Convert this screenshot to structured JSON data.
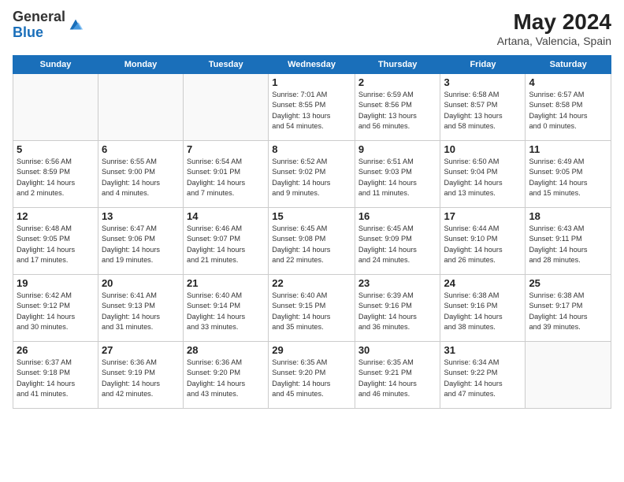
{
  "header": {
    "logo_general": "General",
    "logo_blue": "Blue",
    "month_year": "May 2024",
    "location": "Artana, Valencia, Spain"
  },
  "days_of_week": [
    "Sunday",
    "Monday",
    "Tuesday",
    "Wednesday",
    "Thursday",
    "Friday",
    "Saturday"
  ],
  "weeks": [
    [
      {
        "day": "",
        "info": ""
      },
      {
        "day": "",
        "info": ""
      },
      {
        "day": "",
        "info": ""
      },
      {
        "day": "1",
        "info": "Sunrise: 7:01 AM\nSunset: 8:55 PM\nDaylight: 13 hours\nand 54 minutes."
      },
      {
        "day": "2",
        "info": "Sunrise: 6:59 AM\nSunset: 8:56 PM\nDaylight: 13 hours\nand 56 minutes."
      },
      {
        "day": "3",
        "info": "Sunrise: 6:58 AM\nSunset: 8:57 PM\nDaylight: 13 hours\nand 58 minutes."
      },
      {
        "day": "4",
        "info": "Sunrise: 6:57 AM\nSunset: 8:58 PM\nDaylight: 14 hours\nand 0 minutes."
      }
    ],
    [
      {
        "day": "5",
        "info": "Sunrise: 6:56 AM\nSunset: 8:59 PM\nDaylight: 14 hours\nand 2 minutes."
      },
      {
        "day": "6",
        "info": "Sunrise: 6:55 AM\nSunset: 9:00 PM\nDaylight: 14 hours\nand 4 minutes."
      },
      {
        "day": "7",
        "info": "Sunrise: 6:54 AM\nSunset: 9:01 PM\nDaylight: 14 hours\nand 7 minutes."
      },
      {
        "day": "8",
        "info": "Sunrise: 6:52 AM\nSunset: 9:02 PM\nDaylight: 14 hours\nand 9 minutes."
      },
      {
        "day": "9",
        "info": "Sunrise: 6:51 AM\nSunset: 9:03 PM\nDaylight: 14 hours\nand 11 minutes."
      },
      {
        "day": "10",
        "info": "Sunrise: 6:50 AM\nSunset: 9:04 PM\nDaylight: 14 hours\nand 13 minutes."
      },
      {
        "day": "11",
        "info": "Sunrise: 6:49 AM\nSunset: 9:05 PM\nDaylight: 14 hours\nand 15 minutes."
      }
    ],
    [
      {
        "day": "12",
        "info": "Sunrise: 6:48 AM\nSunset: 9:05 PM\nDaylight: 14 hours\nand 17 minutes."
      },
      {
        "day": "13",
        "info": "Sunrise: 6:47 AM\nSunset: 9:06 PM\nDaylight: 14 hours\nand 19 minutes."
      },
      {
        "day": "14",
        "info": "Sunrise: 6:46 AM\nSunset: 9:07 PM\nDaylight: 14 hours\nand 21 minutes."
      },
      {
        "day": "15",
        "info": "Sunrise: 6:45 AM\nSunset: 9:08 PM\nDaylight: 14 hours\nand 22 minutes."
      },
      {
        "day": "16",
        "info": "Sunrise: 6:45 AM\nSunset: 9:09 PM\nDaylight: 14 hours\nand 24 minutes."
      },
      {
        "day": "17",
        "info": "Sunrise: 6:44 AM\nSunset: 9:10 PM\nDaylight: 14 hours\nand 26 minutes."
      },
      {
        "day": "18",
        "info": "Sunrise: 6:43 AM\nSunset: 9:11 PM\nDaylight: 14 hours\nand 28 minutes."
      }
    ],
    [
      {
        "day": "19",
        "info": "Sunrise: 6:42 AM\nSunset: 9:12 PM\nDaylight: 14 hours\nand 30 minutes."
      },
      {
        "day": "20",
        "info": "Sunrise: 6:41 AM\nSunset: 9:13 PM\nDaylight: 14 hours\nand 31 minutes."
      },
      {
        "day": "21",
        "info": "Sunrise: 6:40 AM\nSunset: 9:14 PM\nDaylight: 14 hours\nand 33 minutes."
      },
      {
        "day": "22",
        "info": "Sunrise: 6:40 AM\nSunset: 9:15 PM\nDaylight: 14 hours\nand 35 minutes."
      },
      {
        "day": "23",
        "info": "Sunrise: 6:39 AM\nSunset: 9:16 PM\nDaylight: 14 hours\nand 36 minutes."
      },
      {
        "day": "24",
        "info": "Sunrise: 6:38 AM\nSunset: 9:16 PM\nDaylight: 14 hours\nand 38 minutes."
      },
      {
        "day": "25",
        "info": "Sunrise: 6:38 AM\nSunset: 9:17 PM\nDaylight: 14 hours\nand 39 minutes."
      }
    ],
    [
      {
        "day": "26",
        "info": "Sunrise: 6:37 AM\nSunset: 9:18 PM\nDaylight: 14 hours\nand 41 minutes."
      },
      {
        "day": "27",
        "info": "Sunrise: 6:36 AM\nSunset: 9:19 PM\nDaylight: 14 hours\nand 42 minutes."
      },
      {
        "day": "28",
        "info": "Sunrise: 6:36 AM\nSunset: 9:20 PM\nDaylight: 14 hours\nand 43 minutes."
      },
      {
        "day": "29",
        "info": "Sunrise: 6:35 AM\nSunset: 9:20 PM\nDaylight: 14 hours\nand 45 minutes."
      },
      {
        "day": "30",
        "info": "Sunrise: 6:35 AM\nSunset: 9:21 PM\nDaylight: 14 hours\nand 46 minutes."
      },
      {
        "day": "31",
        "info": "Sunrise: 6:34 AM\nSunset: 9:22 PM\nDaylight: 14 hours\nand 47 minutes."
      },
      {
        "day": "",
        "info": ""
      }
    ]
  ]
}
